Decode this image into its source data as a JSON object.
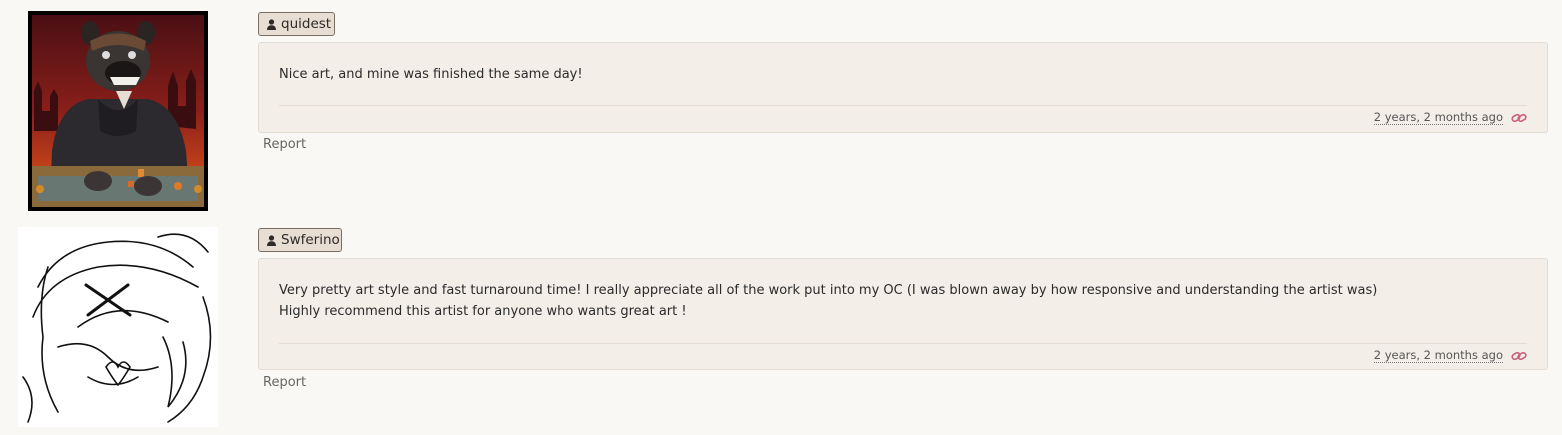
{
  "comments": [
    {
      "username": "quidest",
      "avatar_icon": "user-icon",
      "body": [
        "Nice art, and mine was finished the same day!"
      ],
      "time": "2 years, 2 months ago",
      "report_label": "Report"
    },
    {
      "username": "Swferino",
      "avatar_icon": "user-icon",
      "body": [
        "Very pretty art style and fast turnaround time! I really appreciate all of the work put into my OC (I was blown away by how responsive and understanding the artist was)",
        "Highly recommend this artist for anyone who wants great art !"
      ],
      "time": "2 years, 2 months ago",
      "report_label": "Report"
    }
  ],
  "colors": {
    "page_bg": "#faf8f5",
    "card_bg": "#f3eee8",
    "badge_bg": "#e8ddd2",
    "link_accent": "#c9607a"
  },
  "icons": {
    "user": "user-icon",
    "permalink": "link-icon"
  }
}
